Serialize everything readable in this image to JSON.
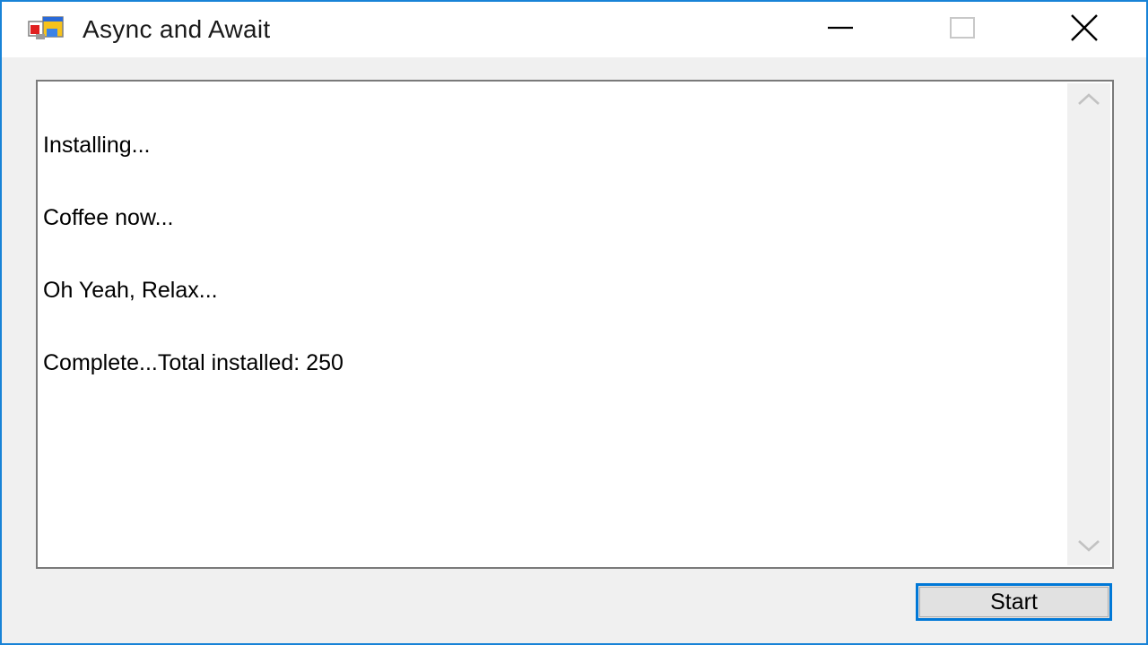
{
  "window": {
    "title": "Async and Await",
    "border_color": "#1883d7",
    "icons": {
      "app": "windows-forms-app-icon",
      "minimize": "minimize-icon",
      "maximize": "maximize-icon",
      "close": "close-icon"
    }
  },
  "log": {
    "lines": [
      "Installing...",
      "Coffee now...",
      "Oh Yeah, Relax...",
      "Complete...Total installed: 250"
    ],
    "scroll_up_icon": "chevron-up-icon",
    "scroll_down_icon": "chevron-down-icon"
  },
  "actions": {
    "start_label": "Start",
    "accent_color": "#0078d7"
  }
}
